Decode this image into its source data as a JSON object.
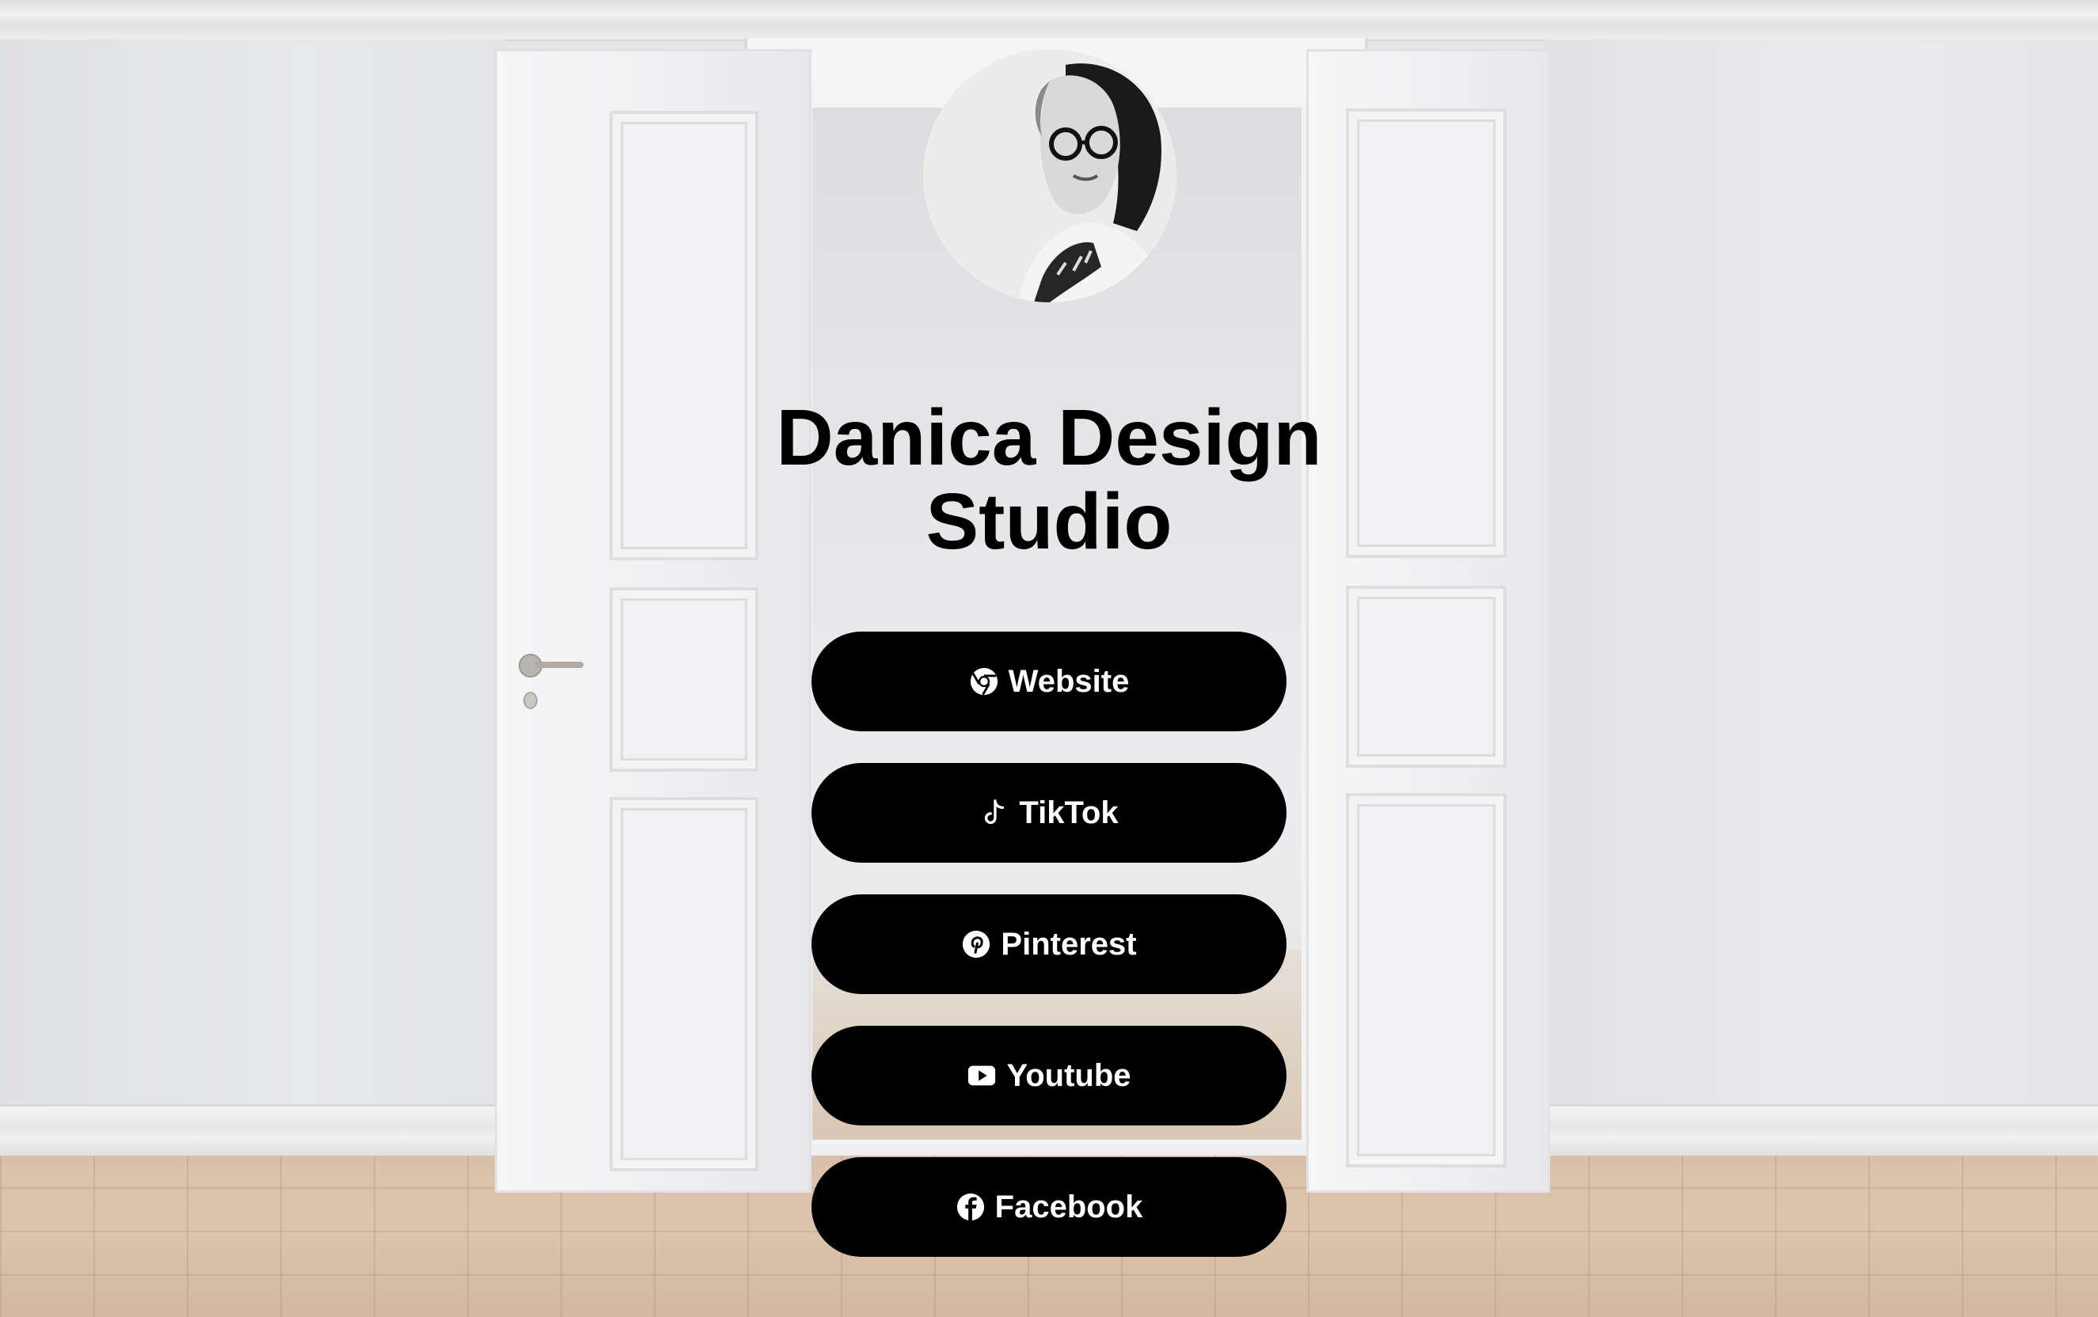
{
  "profile": {
    "avatar": "profile-photo",
    "title": "Danica Design Studio"
  },
  "links": [
    {
      "label": "Website",
      "icon": "chrome-icon"
    },
    {
      "label": "TikTok",
      "icon": "tiktok-icon"
    },
    {
      "label": "Pinterest",
      "icon": "pinterest-icon"
    },
    {
      "label": "Youtube",
      "icon": "youtube-icon"
    },
    {
      "label": "Facebook",
      "icon": "facebook-icon"
    }
  ],
  "colors": {
    "button_bg": "#000000",
    "button_text": "#ffffff",
    "title_text": "#000000"
  }
}
